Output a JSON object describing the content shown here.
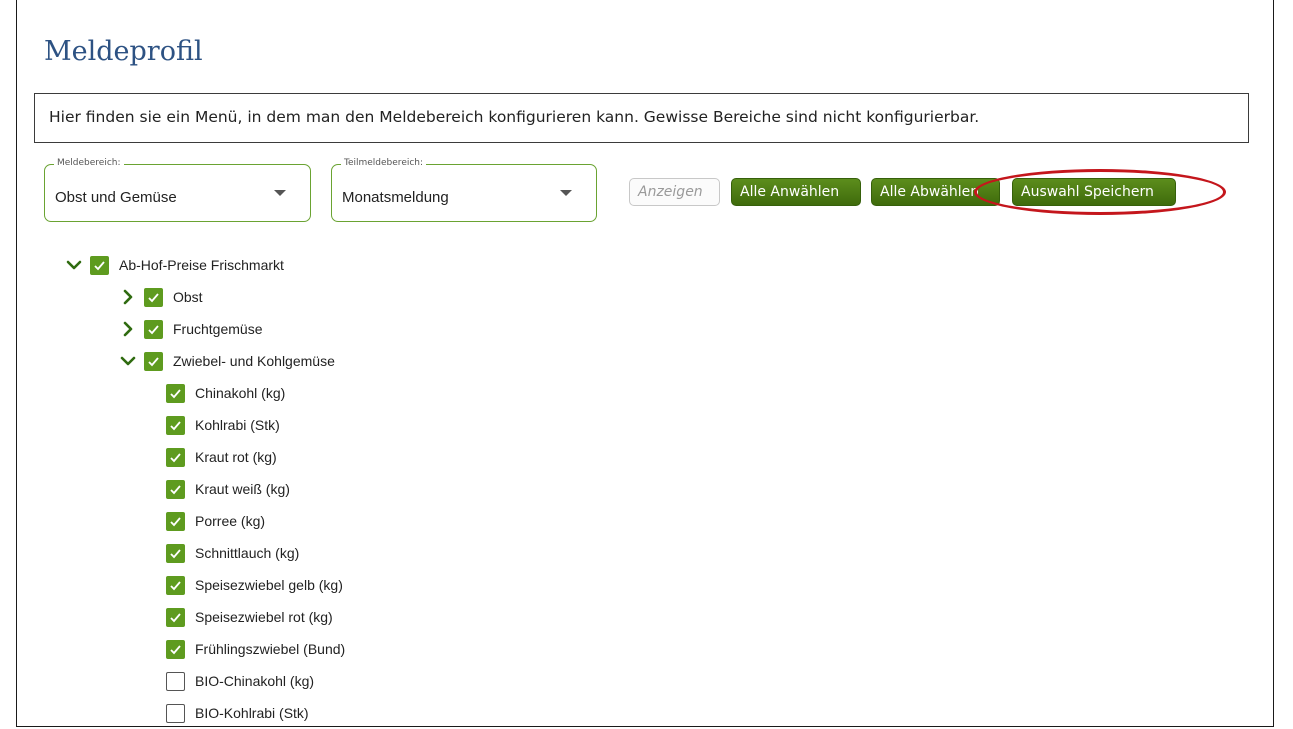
{
  "page": {
    "title": "Meldeprofil",
    "info_text": "Hier finden sie ein Menü, in dem man den Meldebereich konfigurieren kann. Gewisse Bereiche sind nicht konfigurierbar."
  },
  "filters": {
    "meldebereich": {
      "label": "Meldebereich:",
      "value": "Obst und Gemüse"
    },
    "teilmeldebereich": {
      "label": "Teilmeldebereich:",
      "value": "Monatsmeldung"
    }
  },
  "buttons": {
    "anzeigen": "Anzeigen",
    "alle_anwaehlen": "Alle Anwählen",
    "alle_abwaehlen": "Alle Abwählen",
    "auswahl_speichern": "Auswahl Speichern"
  },
  "tree": {
    "root": {
      "label": "Ab-Hof-Preise Frischmarkt",
      "checked": true,
      "expanded": true
    },
    "groups": [
      {
        "label": "Obst",
        "checked": true,
        "expanded": false
      },
      {
        "label": "Fruchtgemüse",
        "checked": true,
        "expanded": false
      },
      {
        "label": "Zwiebel- und Kohlgemüse",
        "checked": true,
        "expanded": true
      }
    ],
    "items": [
      {
        "label": "Chinakohl (kg)",
        "checked": true
      },
      {
        "label": "Kohlrabi (Stk)",
        "checked": true
      },
      {
        "label": "Kraut rot (kg)",
        "checked": true
      },
      {
        "label": "Kraut weiß (kg)",
        "checked": true
      },
      {
        "label": "Porree (kg)",
        "checked": true
      },
      {
        "label": "Schnittlauch (kg)",
        "checked": true
      },
      {
        "label": "Speisezwiebel gelb (kg)",
        "checked": true
      },
      {
        "label": "Speisezwiebel rot (kg)",
        "checked": true
      },
      {
        "label": "Frühlingszwiebel (Bund)",
        "checked": true
      },
      {
        "label": "BIO-Chinakohl (kg)",
        "checked": false
      },
      {
        "label": "BIO-Kohlrabi (Stk)",
        "checked": false
      }
    ]
  },
  "colors": {
    "accent_green": "#5e9b1f",
    "title_blue": "#2d5283",
    "highlight_red": "#c4161c"
  }
}
